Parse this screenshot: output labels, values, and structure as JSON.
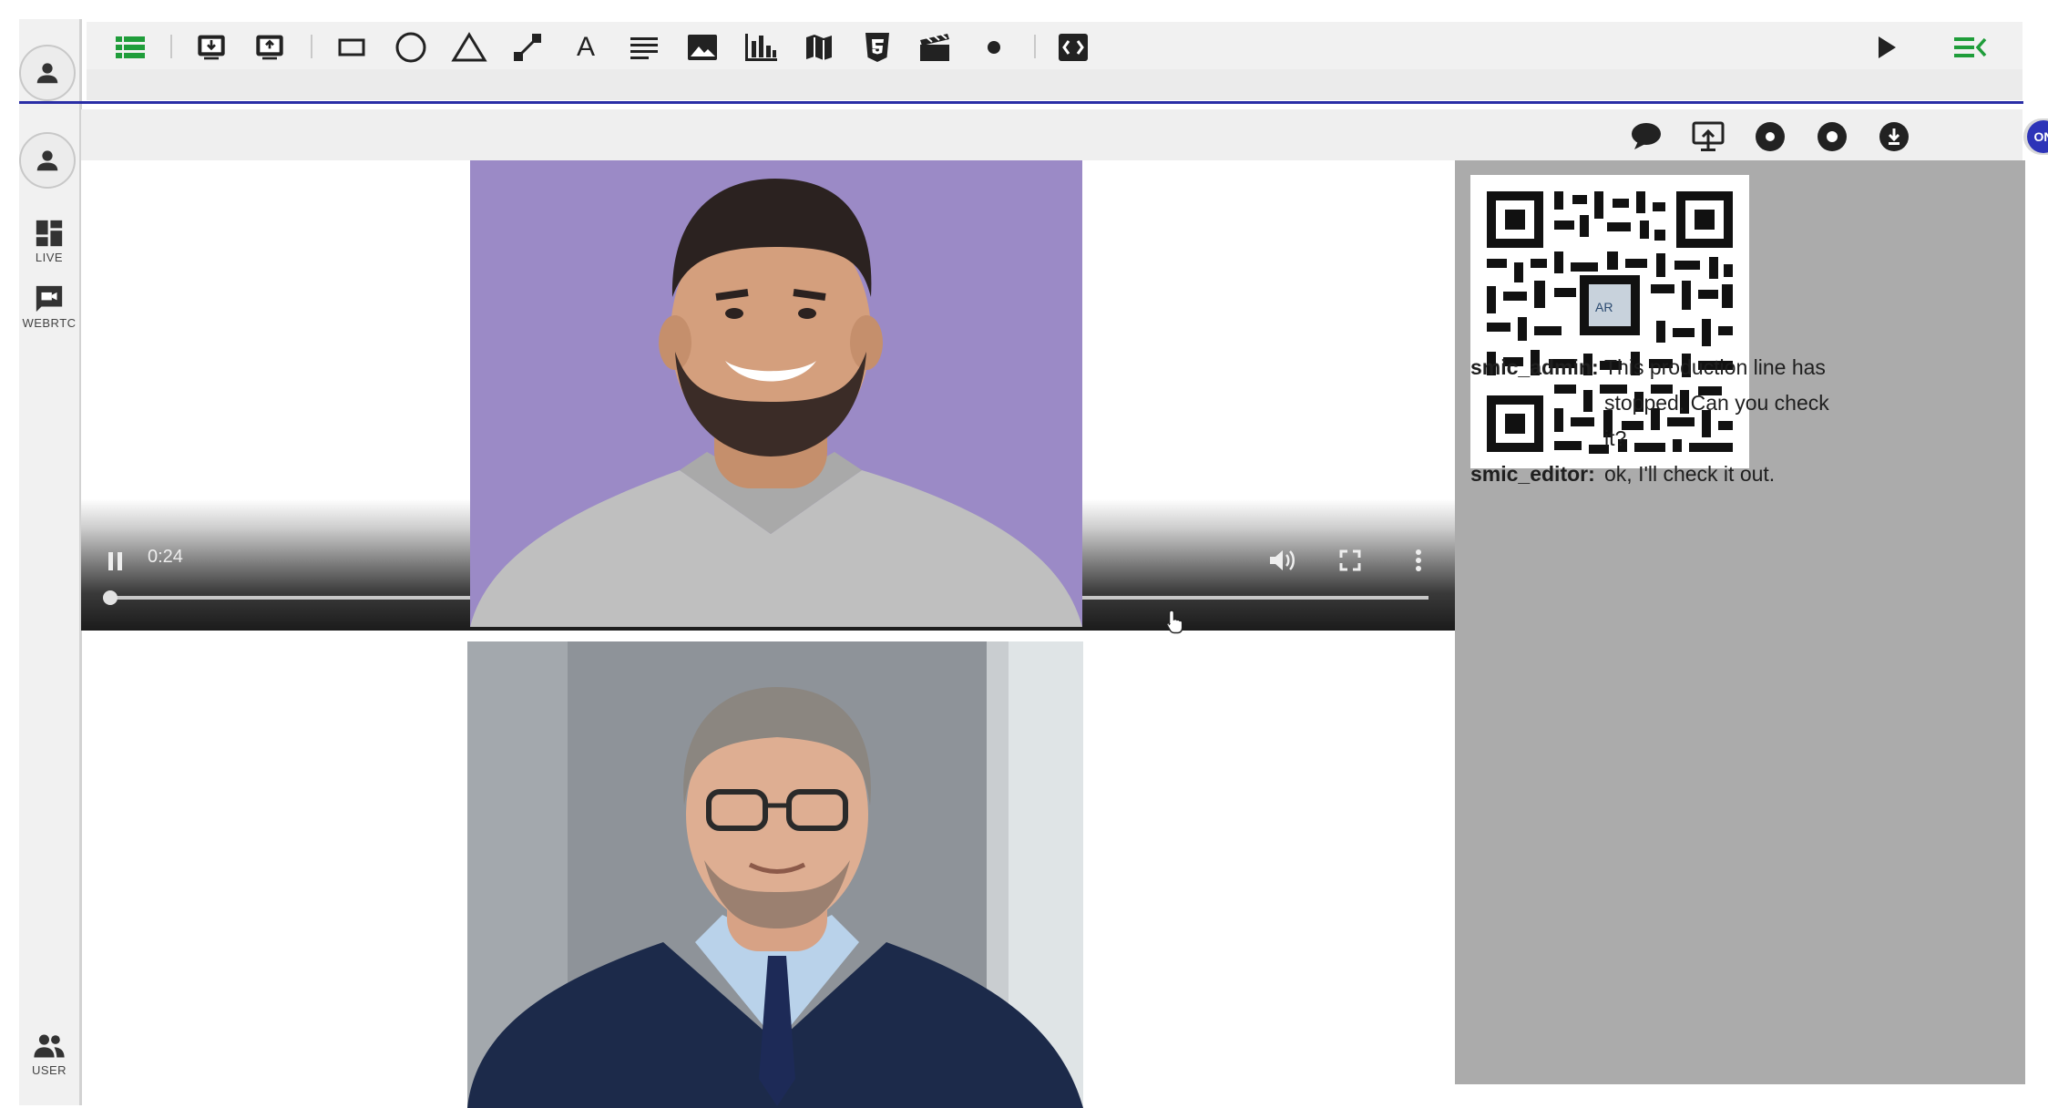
{
  "left_rail": {
    "items": [
      {
        "label": "LIVE",
        "icon": "dashboard-icon"
      },
      {
        "label": "WEBRTC",
        "icon": "video-chat-icon"
      },
      {
        "label": "USER",
        "icon": "users-icon"
      }
    ]
  },
  "toolbar": {
    "icons": [
      "list-icon",
      "screen-download-icon",
      "screen-upload-icon",
      "rectangle-icon",
      "circle-icon",
      "triangle-icon",
      "line-icon",
      "text-icon",
      "paragraph-icon",
      "image-icon",
      "bar-chart-icon",
      "map-icon",
      "html5-icon",
      "video-clip-icon",
      "dot-icon",
      "code-block-icon",
      "play-icon",
      "menu-collapse-icon"
    ],
    "text_tool_glyph": "A"
  },
  "controlbar": {
    "icons": [
      "chat-icon",
      "screen-share-icon",
      "record-dot-icon",
      "stop-dot-icon",
      "download-icon"
    ],
    "toggle_label": "ON"
  },
  "video": {
    "time": "0:24",
    "progress": 0.0
  },
  "chat": {
    "messages": [
      {
        "user": "smic_admin:",
        "lines": [
          "This production line has",
          "stopped. Can you check",
          "it?"
        ]
      },
      {
        "user": "smic_editor:",
        "lines": [
          "ok, I'll check it out."
        ]
      }
    ],
    "qr_logo_text": "AR"
  },
  "colors": {
    "accent_blue": "#2a2ea6",
    "toggle_on": "#2d34b8",
    "list_icon_green": "#1f9d3a",
    "panel_gray": "#ababab"
  }
}
